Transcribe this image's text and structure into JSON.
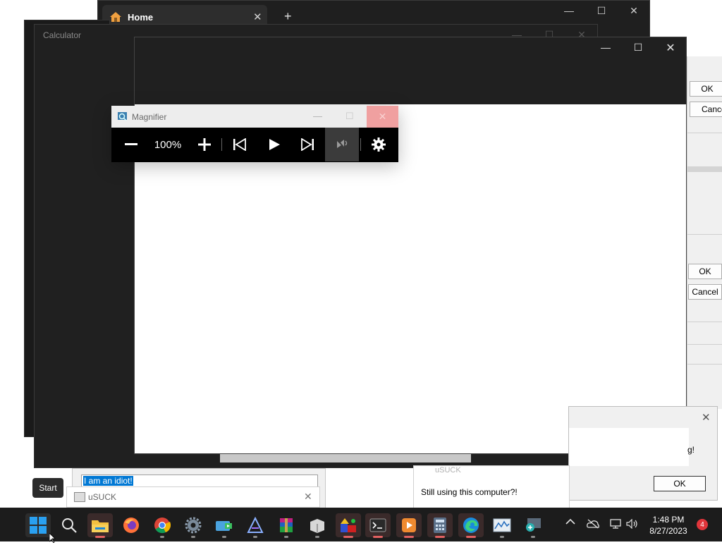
{
  "browser": {
    "tab_title": "Home",
    "new_tab": "+"
  },
  "calculator": {
    "title": "Calculator"
  },
  "magnifier": {
    "title": "Magnifier",
    "zoom": "100%"
  },
  "dialog_right": {
    "ok": "OK",
    "cancel": "Cance",
    "ok2": "OK",
    "cancel2": "Cancel"
  },
  "message_box": {
    "partial_text": "g!",
    "ok": "OK"
  },
  "still_dialog": {
    "text": "Still using this computer?!",
    "title_partial": "uSUCK"
  },
  "usuck": {
    "title": "uSUCK",
    "field": "I am an idiot!"
  },
  "start_tooltip": "Start",
  "taskbar": {
    "time": "1:48 PM",
    "date": "8/27/2023",
    "notifications": "4",
    "apps": [
      "windows-start",
      "search",
      "file-explorer",
      "firefox",
      "chrome",
      "settings",
      "network-tool",
      "ai-app",
      "winrar",
      "box-app",
      "game-app",
      "terminal",
      "media-player",
      "calculator",
      "edge",
      "resource-monitor",
      "magnifier"
    ]
  },
  "colors": {
    "accent": "#0078d4",
    "dark": "#202020",
    "notif": "#e0353b"
  }
}
